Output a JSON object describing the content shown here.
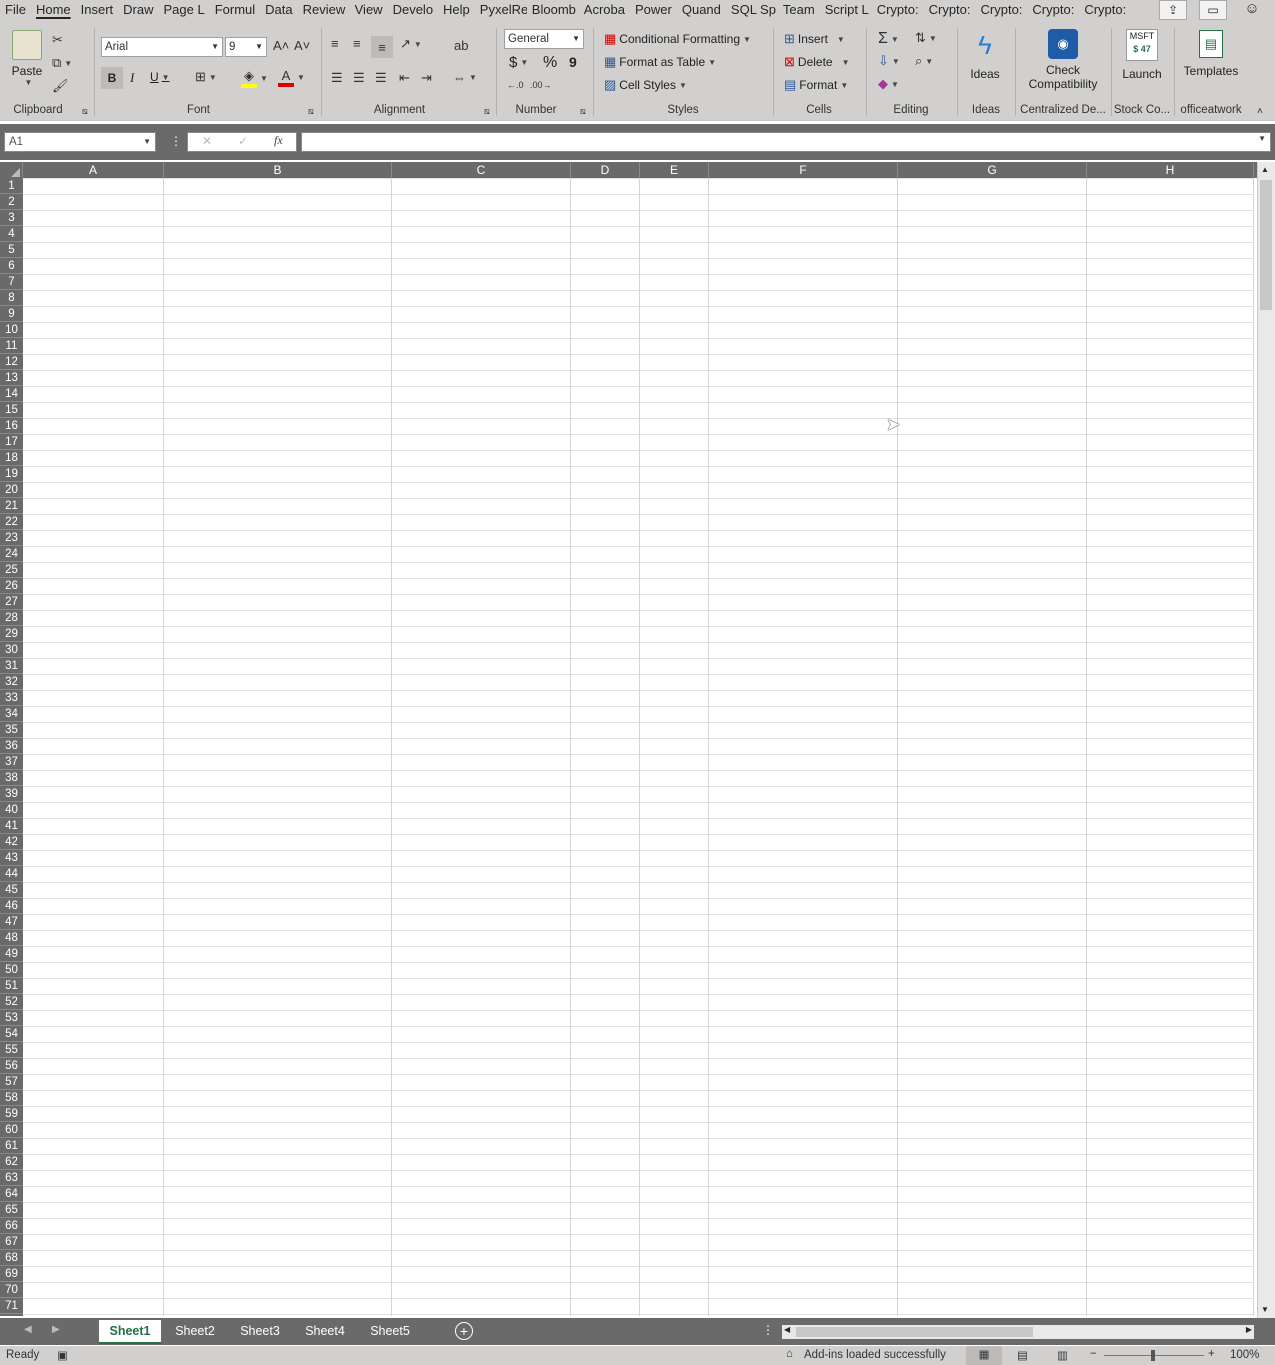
{
  "tabs": [
    "File",
    "Home",
    "Insert",
    "Draw",
    "Page L",
    "Formul",
    "Data",
    "Review",
    "View",
    "Develo",
    "Help",
    "PyxelRe",
    "Bloomb",
    "Acroba",
    "Power",
    "Quand",
    "SQL Sp",
    "Team",
    "Script L",
    "Crypto:",
    "Crypto:",
    "Crypto:",
    "Crypto:",
    "Crypto:"
  ],
  "active_tab": "Home",
  "clipboard": {
    "paste": "Paste",
    "label": "Clipboard"
  },
  "font": {
    "name": "Arial",
    "size": "9",
    "label": "Font",
    "bold": "B",
    "italic": "I",
    "underline": "U"
  },
  "alignment": {
    "label": "Alignment"
  },
  "number": {
    "format": "General",
    "label": "Number",
    "currency": "$",
    "percent": "%",
    "comma": "9"
  },
  "styles": {
    "conditional": "Conditional Formatting",
    "format_table": "Format as Table",
    "cell_styles": "Cell Styles",
    "label": "Styles"
  },
  "cells": {
    "insert": "Insert",
    "delete": "Delete",
    "format": "Format",
    "label": "Cells"
  },
  "editing": {
    "label": "Editing"
  },
  "ideas": {
    "button": "Ideas",
    "label": "Ideas"
  },
  "centralized": {
    "button_line1": "Check",
    "button_line2": "Compatibility",
    "label": "Centralized De..."
  },
  "stock": {
    "ticker": "MSFT",
    "price": "$ 47",
    "button": "Launch",
    "label": "Stock Co..."
  },
  "officeatwork": {
    "button": "Templates",
    "label": "officeatwork"
  },
  "formula_bar": {
    "name_box": "A1",
    "fx": "fx",
    "value": ""
  },
  "columns": [
    "A",
    "B",
    "C",
    "D",
    "E",
    "F",
    "G",
    "H"
  ],
  "rows": [
    "1",
    "2",
    "3",
    "4",
    "5",
    "6",
    "7",
    "8",
    "9",
    "10",
    "11",
    "12",
    "13",
    "14",
    "15",
    "16",
    "17",
    "18",
    "19",
    "20",
    "21",
    "22",
    "23",
    "24",
    "25",
    "26",
    "27",
    "28",
    "29",
    "30",
    "31",
    "32",
    "33",
    "34",
    "35",
    "36",
    "37",
    "38",
    "39",
    "40",
    "41",
    "42",
    "43",
    "44",
    "45",
    "46",
    "47",
    "48",
    "49",
    "50",
    "51",
    "52",
    "53",
    "54",
    "55",
    "56",
    "57",
    "58",
    "59",
    "60",
    "61",
    "62",
    "63",
    "64",
    "65",
    "66",
    "67",
    "68",
    "69",
    "70",
    "71"
  ],
  "sheets": [
    "Sheet1",
    "Sheet2",
    "Sheet3",
    "Sheet4",
    "Sheet5"
  ],
  "active_sheet": "Sheet1",
  "status": {
    "ready": "Ready",
    "addins": "Add-ins loaded successfully",
    "zoom": "100%"
  }
}
